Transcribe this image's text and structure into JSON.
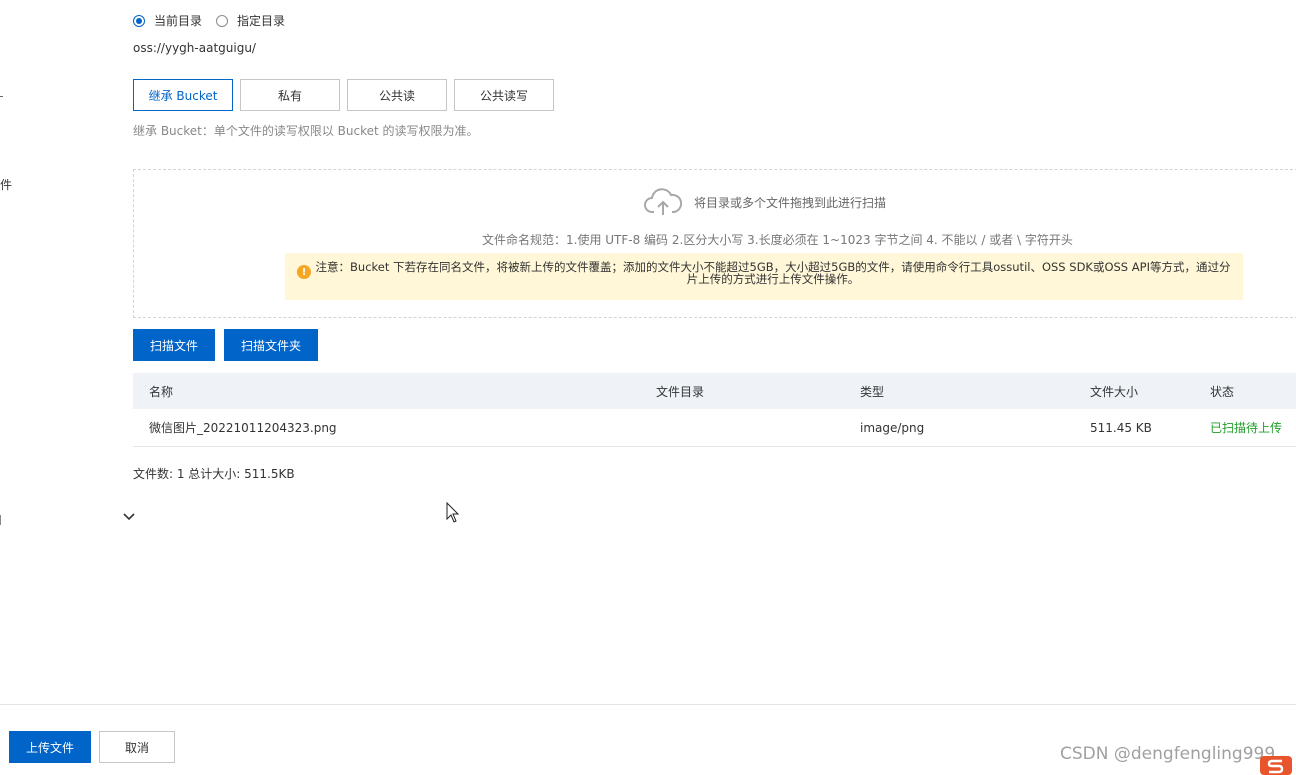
{
  "sidebar_labels": {
    "file_label": "件",
    "partial_label": "置"
  },
  "directory": {
    "options": [
      {
        "label": "当前目录",
        "checked": true
      },
      {
        "label": "指定目录",
        "checked": false
      }
    ],
    "path": "oss://yygh-aatguigu/"
  },
  "acl": {
    "buttons": [
      {
        "label": "继承 Bucket",
        "active": true
      },
      {
        "label": "私有",
        "active": false
      },
      {
        "label": "公共读",
        "active": false
      },
      {
        "label": "公共读写",
        "active": false
      }
    ],
    "hint": "继承 Bucket：单个文件的读写权限以 Bucket 的读写权限为准。"
  },
  "dropzone": {
    "main_text": "将目录或多个文件拖拽到此进行扫描",
    "rules": "文件命名规范：1.使用 UTF-8 编码 2.区分大小写 3.长度必须在 1~1023 字节之间 4. 不能以 / 或者 \\ 字符开头",
    "notice_icon": "!",
    "notice": "注意：Bucket 下若存在同名文件，将被新上传的文件覆盖；添加的文件大小不能超过5GB，大小超过5GB的文件，请使用命令行工具ossutil、OSS SDK或OSS API等方式，通过分片上传的方式进行上传文件操作。"
  },
  "scan_buttons": {
    "scan_file": "扫描文件",
    "scan_folder": "扫描文件夹"
  },
  "table": {
    "headers": {
      "name": "名称",
      "dir": "文件目录",
      "type": "类型",
      "size": "文件大小",
      "status": "状态"
    },
    "rows": [
      {
        "name": "微信图片_20221011204323.png",
        "dir": "",
        "type": "image/png",
        "size": "511.45 KB",
        "status": "已扫描待上传"
      }
    ]
  },
  "summary": "文件数: 1  总计大小: 511.5KB",
  "footer": {
    "upload": "上传文件",
    "cancel": "取消"
  },
  "watermark": "CSDN @dengfengling999",
  "colors": {
    "primary": "#0064c8",
    "success": "#1e9e28",
    "notice_bg": "#fff7d8",
    "header_bg": "#eff3f8"
  },
  "icons": [
    "radio-icon",
    "cloud-upload-icon",
    "warning-icon",
    "chevron-down-icon",
    "mouse-cursor-icon",
    "csdn-logo-icon"
  ]
}
